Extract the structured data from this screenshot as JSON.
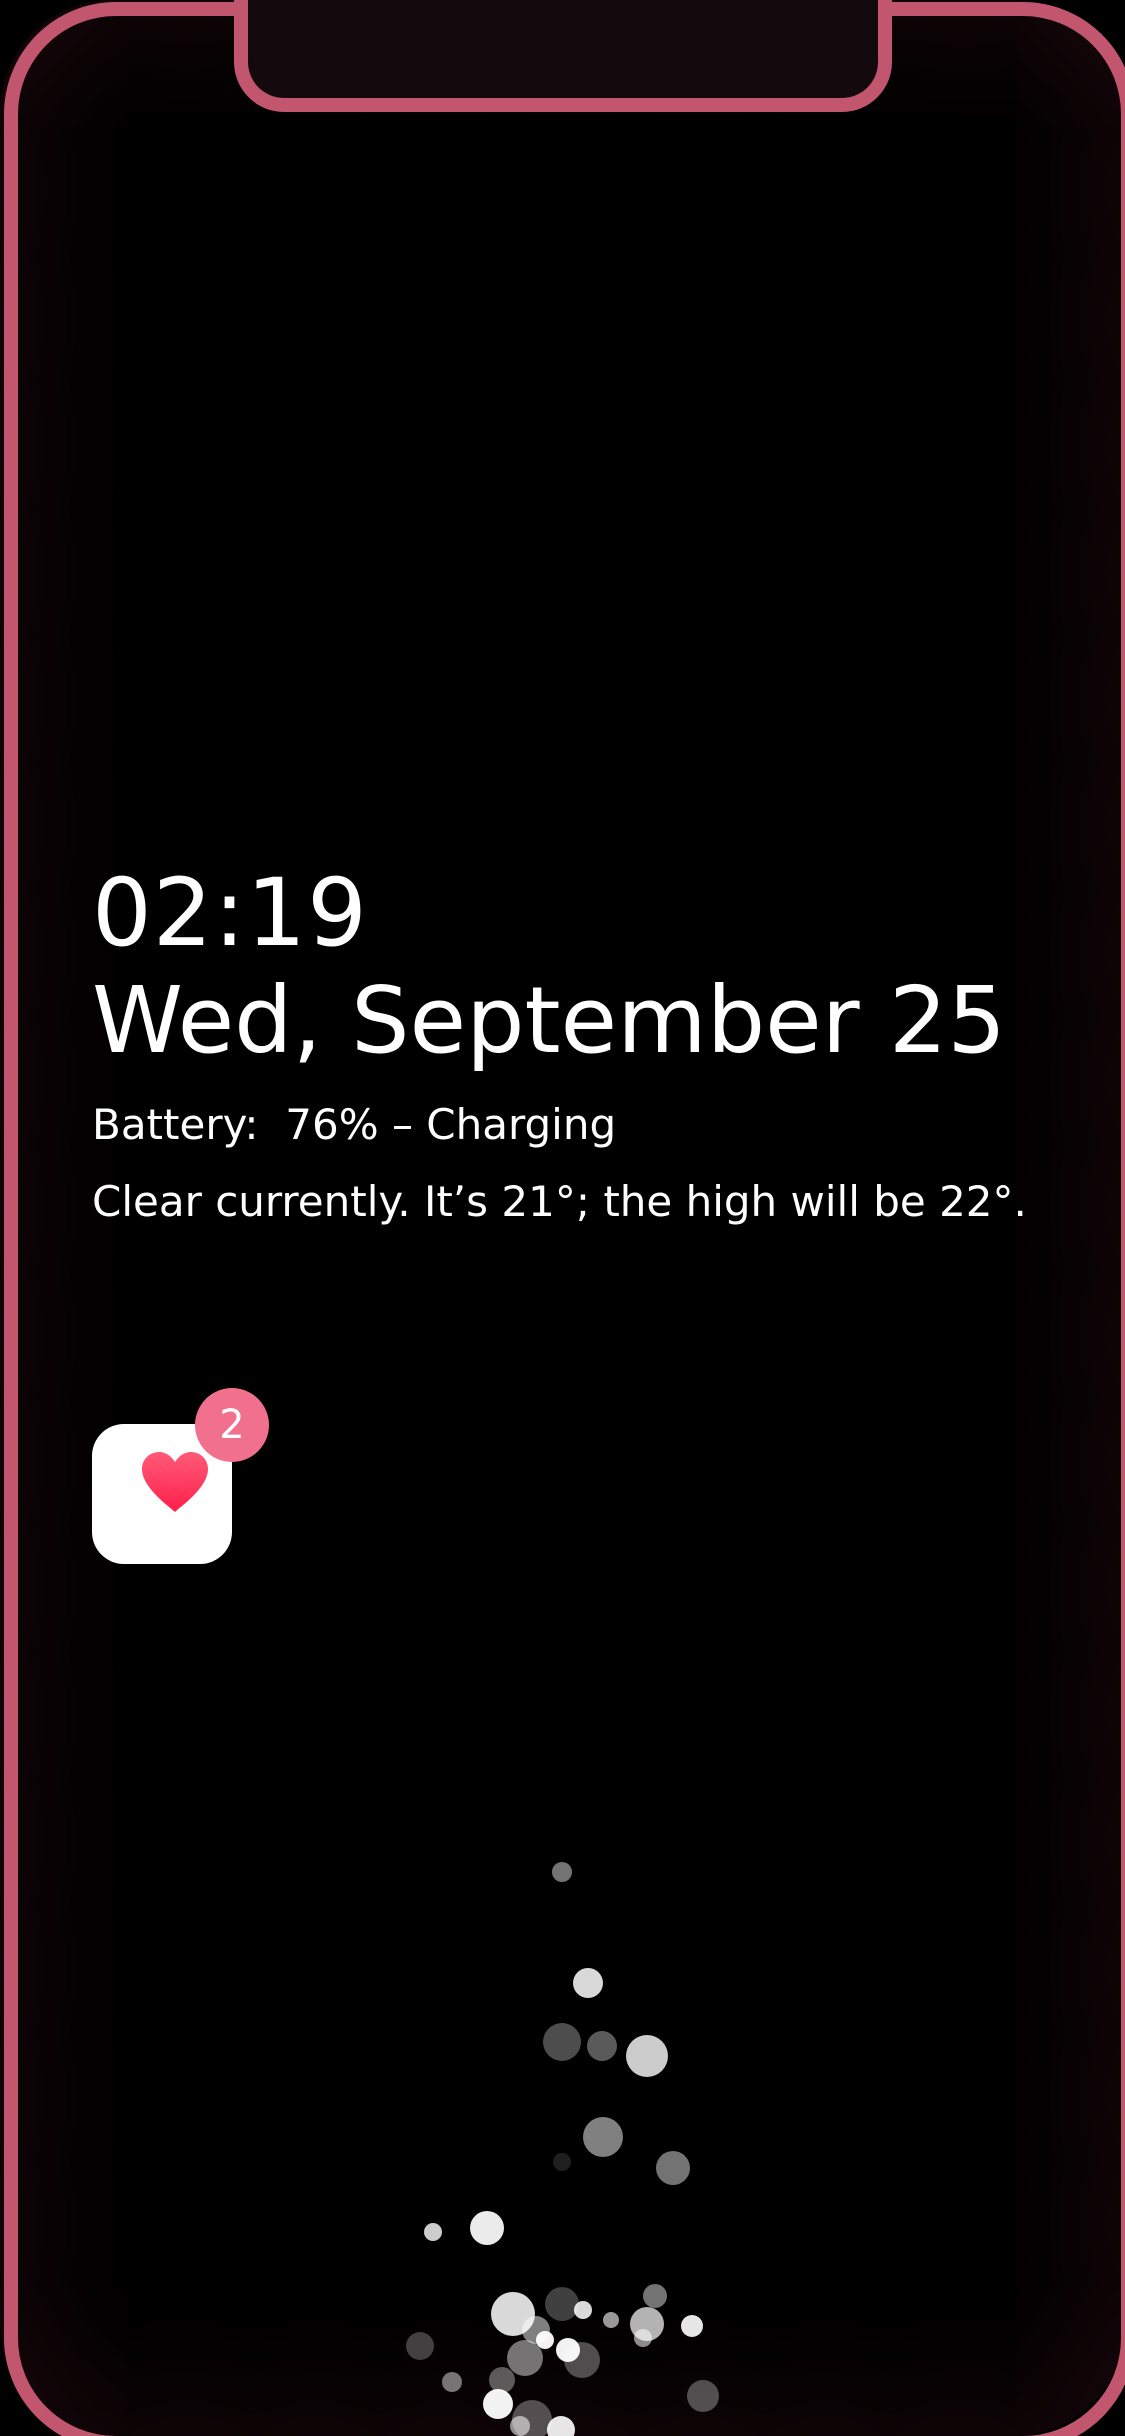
{
  "lock_screen": {
    "time": "02:19",
    "date": "Wed, September 25",
    "battery": "Battery:  76% – Charging",
    "weather": "Clear currently. It’s 21°; the high will be 22°."
  },
  "app_icon": {
    "name": "heart-icon",
    "badge_count": "2",
    "heart_color": "#ff2d55",
    "badge_color": "#f0708e"
  },
  "colors": {
    "background": "#000000",
    "frame": "#c2566e",
    "text": "#ffffff"
  }
}
